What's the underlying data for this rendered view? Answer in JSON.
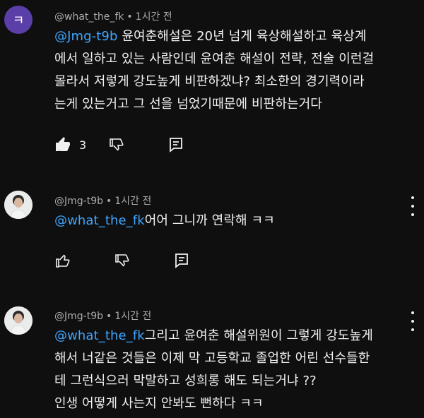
{
  "comments": [
    {
      "avatar_letter": "ㅋ",
      "author": "@what_the_fk",
      "separator": "•",
      "time": "1시간 전",
      "mention": "@Jmg-t9b",
      "text": " 윤여춘해설은 20년 넘게 육상해설하고 육상계\n에서 일하고 있는 사람인데 윤여춘 해설이 전략, 전술 이런걸\n몰라서 저렇게 강도높게 비판하겠냐? 최소한의 경기력이라\n는게 있는거고 그 선을 넘었기때문에 비판하는거다",
      "like_count": "3"
    },
    {
      "author": "@Jmg-t9b",
      "separator": "•",
      "time": "1시간 전",
      "mention": "@what_the_fk",
      "text": "어어 그니까 연락해 ㅋㅋ"
    },
    {
      "author": "@Jmg-t9b",
      "separator": "•",
      "time": "1시간 전",
      "mention": "@what_the_fk",
      "text": "그리고 윤여춘 해설위원이 그렇게 강도높게\n해서 너같은 것들은 이제 막 고등학교 졸업한 어린 선수들한\n테 그런식으러 막말하고 성희롱 해도 되는거냐 ??\n인생 어떻게 사는지 안봐도 뻔하다 ㅋㅋ"
    }
  ],
  "icons": {
    "like": "thumbs-up-icon",
    "dislike": "thumbs-down-icon",
    "reply": "reply-icon",
    "more": "more-vert-icon"
  },
  "colors": {
    "background": "#0f0f0f",
    "mention": "#3ea6ff",
    "meta": "#aaaaaa",
    "avatar": "#5b3fa8"
  }
}
